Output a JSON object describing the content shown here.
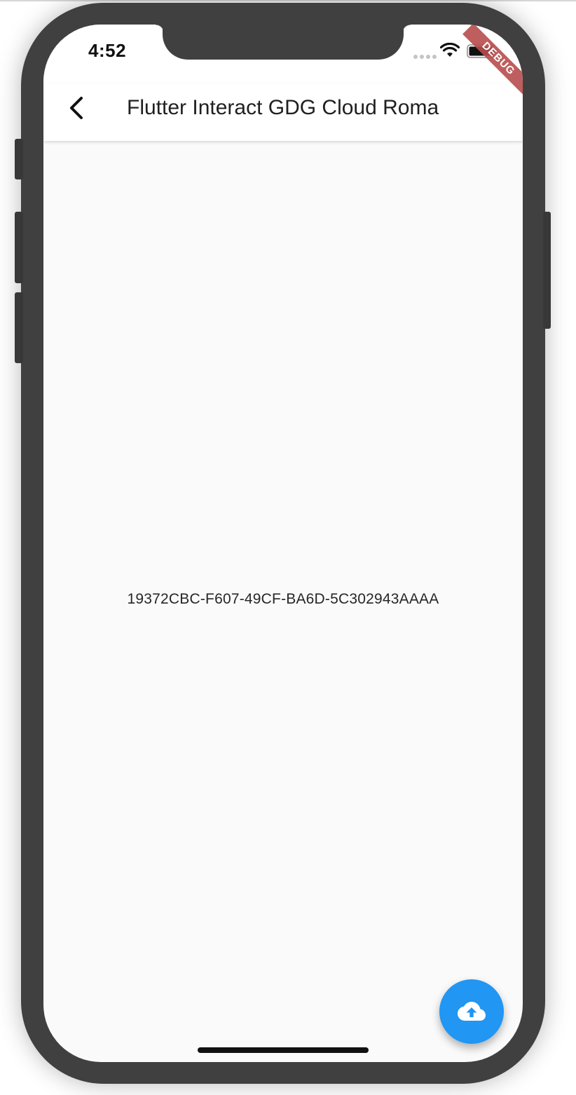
{
  "status_bar": {
    "time": "4:52"
  },
  "app_bar": {
    "title": "Flutter Interact GDG Cloud Roma",
    "back_icon": "chevron-left-icon"
  },
  "body": {
    "identifier": "19372CBC-F607-49CF-BA6D-5C302943AAAA"
  },
  "debug_banner": {
    "label": "DEBUG"
  },
  "fab": {
    "icon": "cloud-upload-icon"
  },
  "colors": {
    "accent": "#2196f3",
    "debug_banner": "#b84c4c",
    "device_frame": "#404040",
    "screen_background": "#fafafa"
  }
}
